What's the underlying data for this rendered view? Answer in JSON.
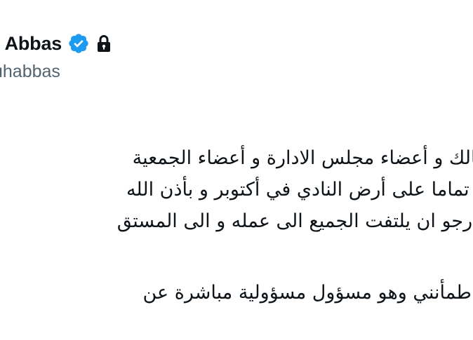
{
  "profile": {
    "display_name": "n Abbas",
    "handle": "uhabbas",
    "verified_icon": "verified-badge-icon",
    "protected_icon": "lock-icon"
  },
  "tweet": {
    "lines": [
      "ي الزمالك و أعضاء مجلس الادارة و أعضاء الجمعية",
      "مأنت تماما على أرض النادي في أكتوبر و بأذن الله",
      "ي و ارجو ان يلتفت الجميع الى عمله و الى المستق",
      "معه و طمأنني وهو مسؤول مسؤولية مباشرة عن"
    ]
  },
  "colors": {
    "text": "#0f1419",
    "secondary_text": "#536471",
    "verified_blue": "#1d9bf0",
    "background": "#ffffff"
  }
}
